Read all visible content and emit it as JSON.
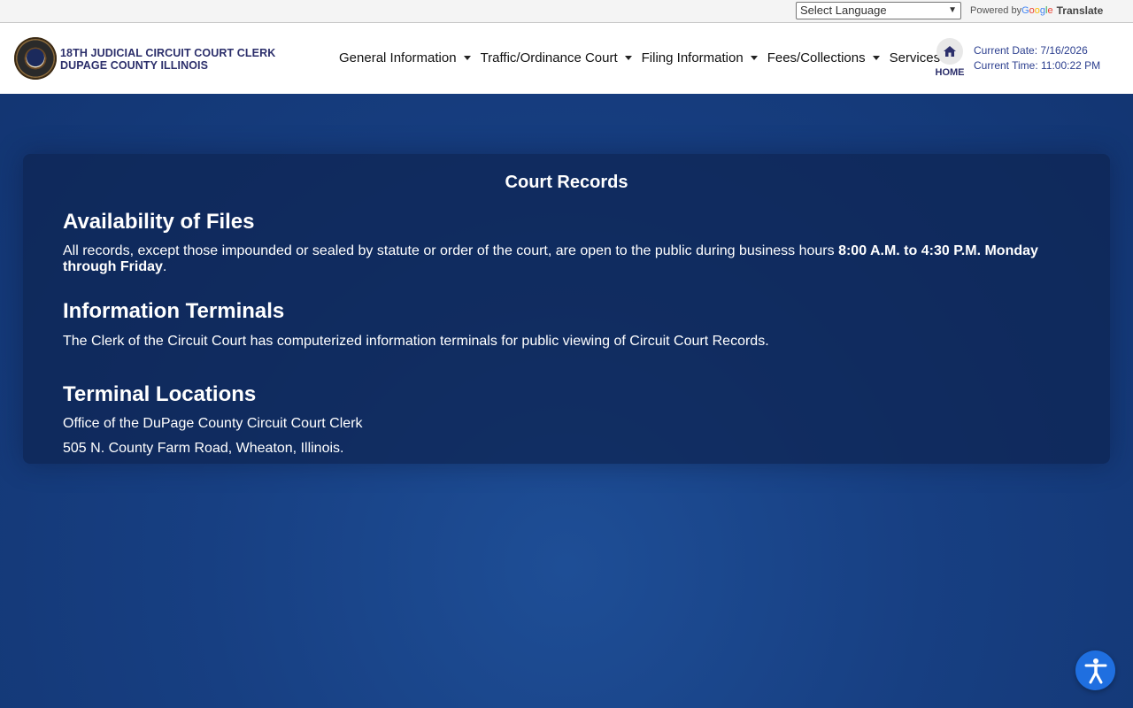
{
  "translate": {
    "select_label": "Select Language",
    "powered_by": "Powered by",
    "google": [
      "G",
      "o",
      "o",
      "g",
      "l",
      "e"
    ],
    "translate_link": "Translate"
  },
  "header": {
    "brand_line1": "18TH JUDICIAL CIRCUIT COURT CLERK",
    "brand_line2": "DUPAGE COUNTY ILLINOIS",
    "nav": [
      {
        "label": "General Information"
      },
      {
        "label": "Traffic/Ordinance Court"
      },
      {
        "label": "Filing Information"
      },
      {
        "label": "Fees/Collections"
      },
      {
        "label": "Services"
      }
    ],
    "home_label": "HOME",
    "current_date": "Current Date: 7/16/2026",
    "current_time": "Current Time: 11:00:22 PM"
  },
  "main": {
    "title": "Court Records",
    "sections": [
      {
        "heading": "Availability of Files",
        "text_before": "All records, except those impounded or sealed by statute or order of the court, are open to the public during business hours ",
        "text_bold": "8:00 A.M. to 4:30 P.M. Monday through Friday",
        "text_after": "."
      },
      {
        "heading": "Information Terminals",
        "text": "The Clerk of the Circuit Court has computerized information terminals for public viewing of Circuit Court Records."
      },
      {
        "heading": "Terminal Locations",
        "line1": "Office of the DuPage County Circuit Court Clerk",
        "line2": "505 N. County Farm Road, Wheaton, Illinois."
      }
    ]
  },
  "icons": {
    "home": "home-icon",
    "accessibility": "accessibility-icon",
    "dropdown": "chevron-down-icon"
  },
  "colors": {
    "brand_navy": "#2c2f6b",
    "page_blue": "#173f82",
    "accessibility_blue": "#1f6fe0"
  }
}
